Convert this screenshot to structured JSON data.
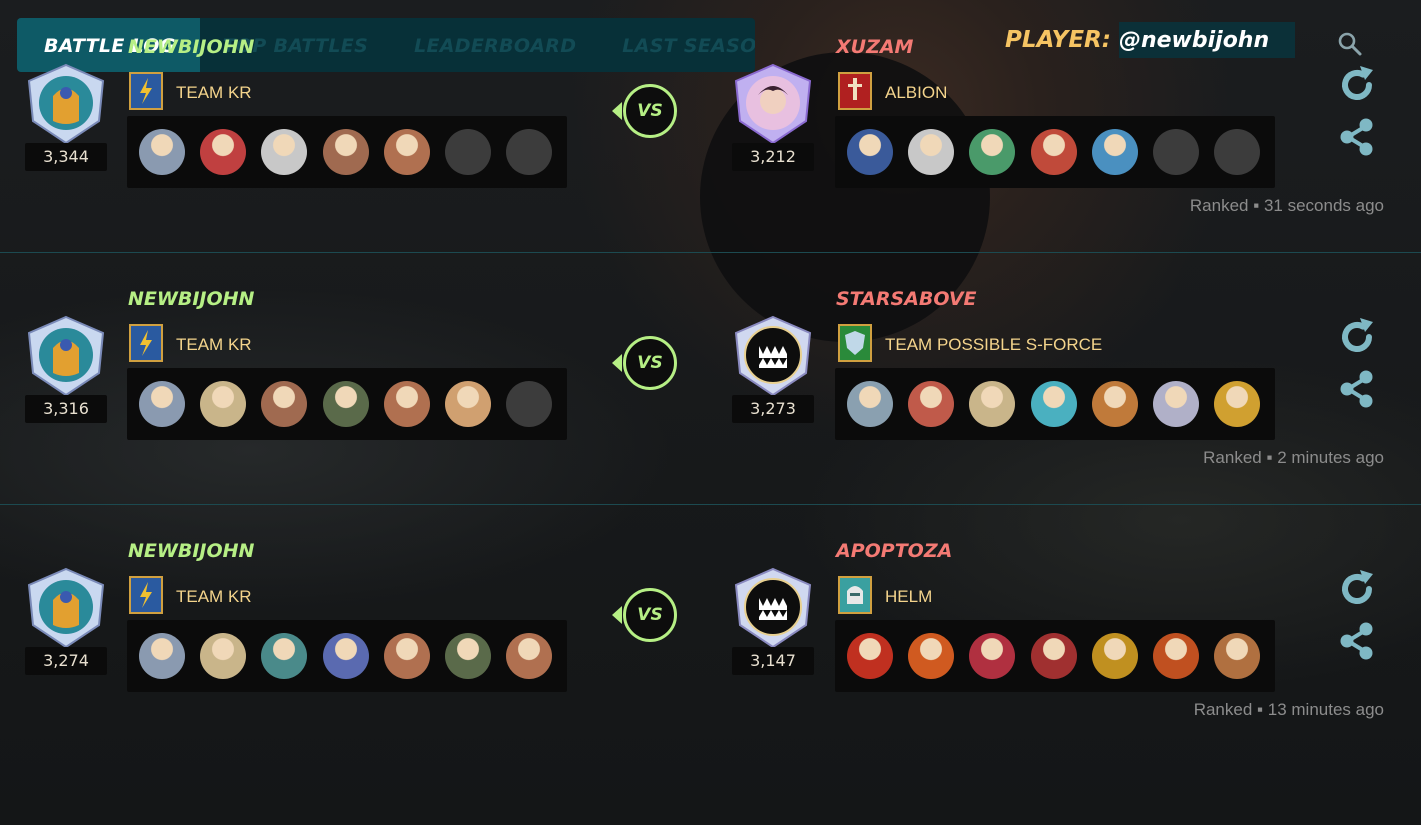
{
  "nav": {
    "tabs": [
      "BATTLE LOG",
      "TOP BATTLES",
      "LEADERBOARD",
      "LAST SEASON"
    ]
  },
  "player": {
    "label": "PLAYER:",
    "value": "@newbijohn"
  },
  "colors": {
    "accent": "#b6ef85",
    "opponent": "#f47a74",
    "guild_text": "#f4d48c",
    "nav_bg": "#073038",
    "replay": "#7fb8c4"
  },
  "battles": [
    {
      "me": {
        "name": "NEWBIJOHN",
        "guild": "TEAM KR",
        "rating": "3,344",
        "team_size": 5
      },
      "vs": "VS",
      "opp": {
        "name": "XUZAM",
        "guild": "ALBION",
        "rating": "3,212",
        "team_size": 5
      },
      "meta": "Ranked ▪ 31 seconds ago"
    },
    {
      "me": {
        "name": "NEWBIJOHN",
        "guild": "TEAM KR",
        "rating": "3,316",
        "team_size": 6
      },
      "vs": "VS",
      "opp": {
        "name": "STARSABOVE",
        "guild": "TEAM POSSIBLE S-FORCE",
        "rating": "3,273",
        "team_size": 7
      },
      "meta": "Ranked ▪ 2 minutes ago"
    },
    {
      "me": {
        "name": "NEWBIJOHN",
        "guild": "TEAM KR",
        "rating": "3,274",
        "team_size": 7
      },
      "vs": "VS",
      "opp": {
        "name": "APOPTOZA",
        "guild": "HELM",
        "rating": "3,147",
        "team_size": 7
      },
      "meta": "Ranked ▪ 13 minutes ago"
    }
  ]
}
